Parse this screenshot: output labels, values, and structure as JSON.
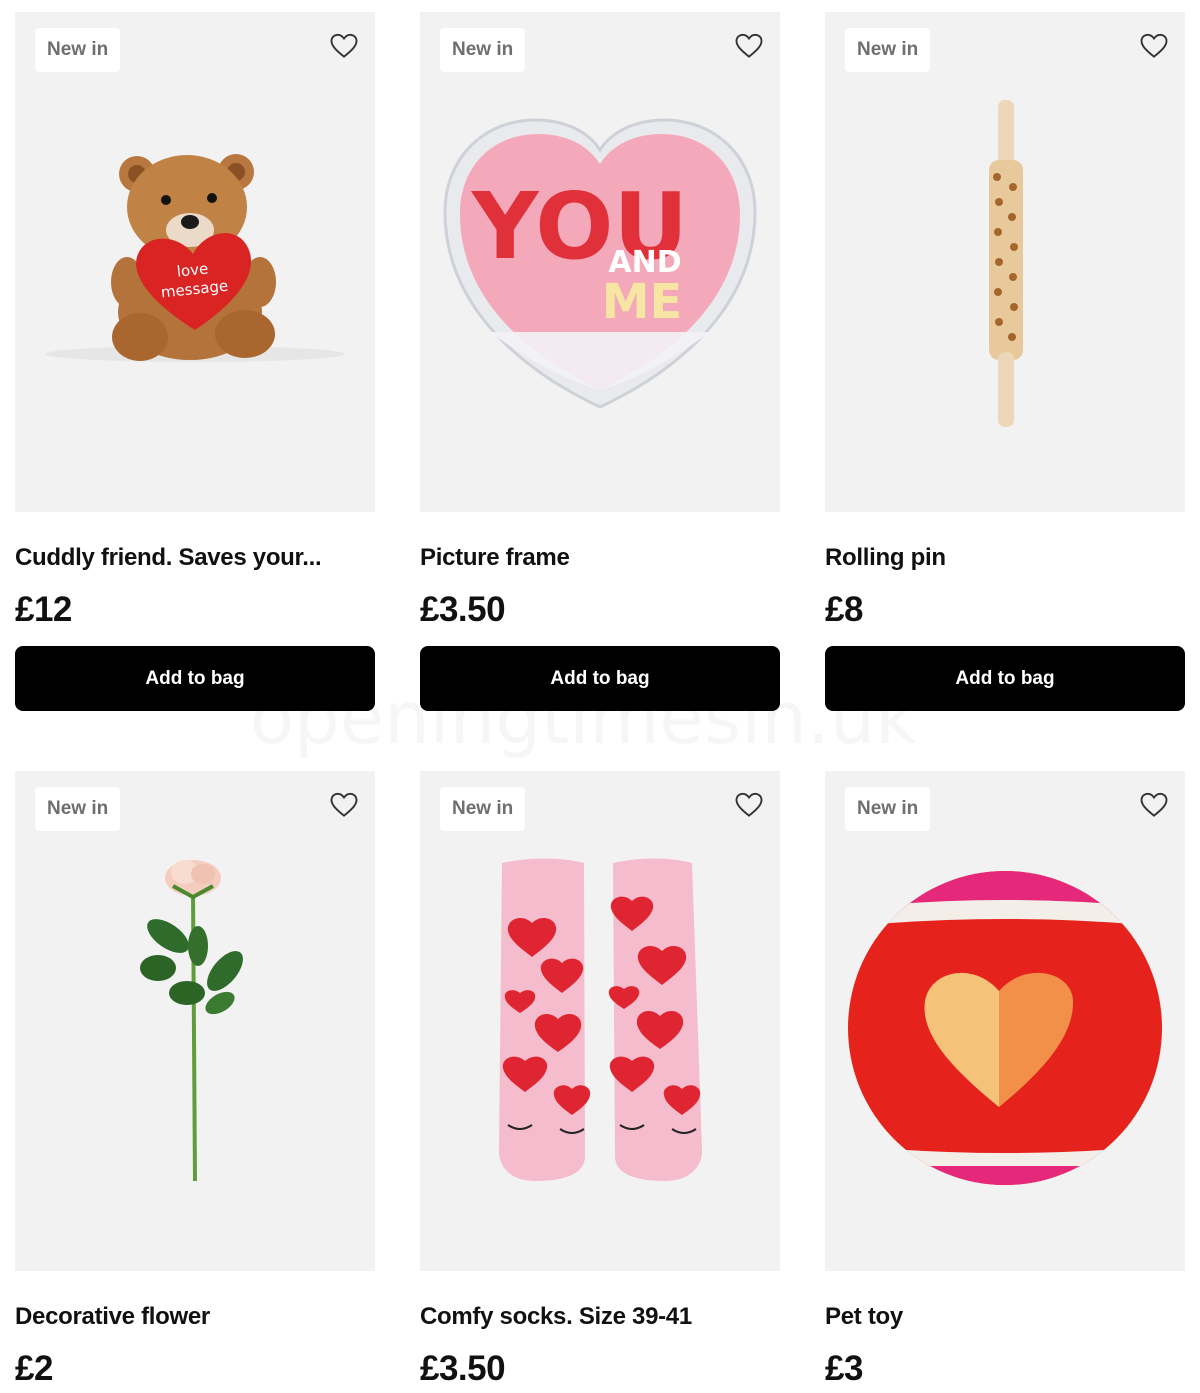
{
  "products": [
    {
      "badge": "New in",
      "title": "Cuddly friend. Saves your...",
      "price": "£12",
      "button": "Add to bag"
    },
    {
      "badge": "New in",
      "title": "Picture frame",
      "price": "£3.50",
      "button": "Add to bag"
    },
    {
      "badge": "New in",
      "title": "Rolling pin",
      "price": "£8",
      "button": "Add to bag"
    },
    {
      "badge": "New in",
      "title": "Decorative flower",
      "price": "£2",
      "button": ""
    },
    {
      "badge": "New in",
      "title": "Comfy socks. Size 39-41",
      "price": "£3.50",
      "button": ""
    },
    {
      "badge": "New in",
      "title": "Pet toy",
      "price": "£3",
      "button": ""
    }
  ],
  "teddy_heart_text": [
    "love",
    "message"
  ],
  "frame_text": [
    "YOU",
    "AND",
    "ME"
  ],
  "watermark": "openingtimesin.uk",
  "icons": {
    "wishlist": "heart-outline-icon"
  },
  "colors": {
    "button_bg": "#000000",
    "tile_bg": "#f2f2f2",
    "badge_text": "#6f6f6f"
  }
}
